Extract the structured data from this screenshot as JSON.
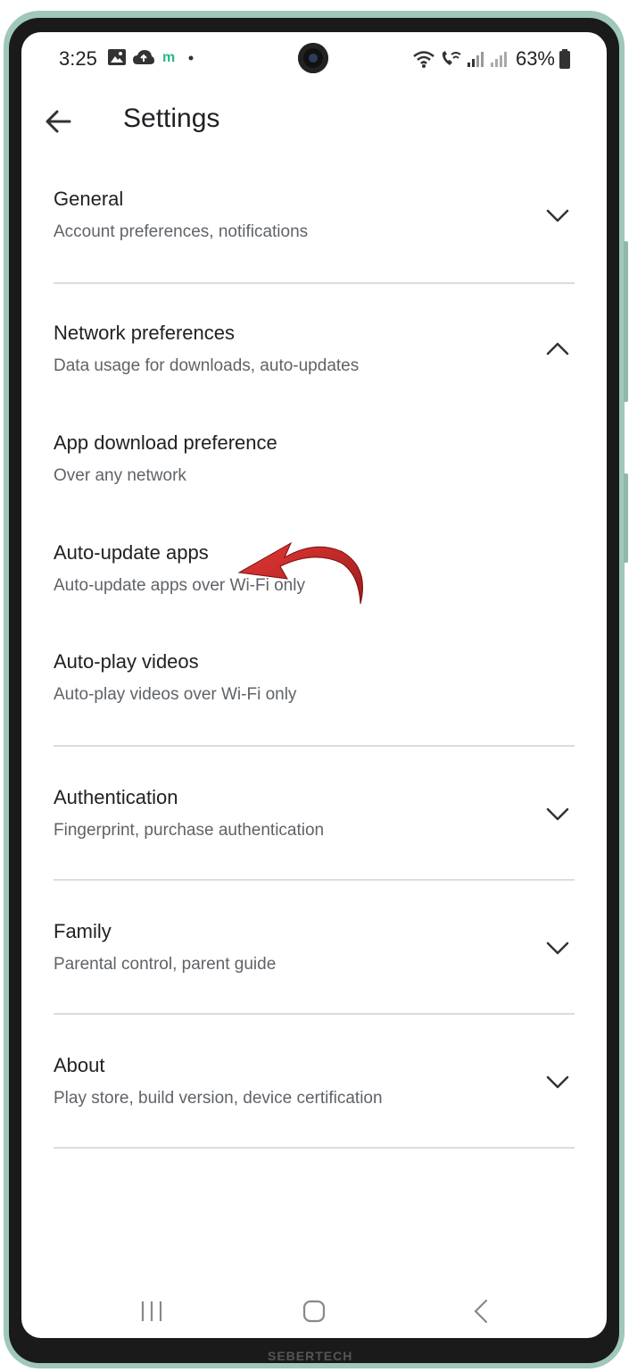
{
  "status_bar": {
    "time": "3:25",
    "battery_percent": "63%",
    "left_icons": [
      "image-icon",
      "cloud-upload-icon",
      "m-app-icon",
      "dot-icon"
    ],
    "right_icons": [
      "wifi-icon",
      "wifi-call-icon",
      "signal-icon",
      "signal-empty-icon",
      "battery-icon"
    ]
  },
  "app_bar": {
    "title": "Settings",
    "back_icon": "arrow-back-icon"
  },
  "sections": [
    {
      "title": "General",
      "subtitle": "Account preferences, notifications",
      "expanded": false
    },
    {
      "title": "Network preferences",
      "subtitle": "Data usage for downloads, auto-updates",
      "expanded": true
    },
    {
      "title": "App download preference",
      "subtitle": "Over any network"
    },
    {
      "title": "Auto-update apps",
      "subtitle": "Auto-update apps over Wi-Fi only"
    },
    {
      "title": "Auto-play videos",
      "subtitle": "Auto-play videos over Wi-Fi only"
    },
    {
      "title": "Authentication",
      "subtitle": "Fingerprint, purchase authentication",
      "expanded": false
    },
    {
      "title": "Family",
      "subtitle": "Parental control, parent guide",
      "expanded": false
    },
    {
      "title": "About",
      "subtitle": "Play store, build version, device certification",
      "expanded": false
    }
  ],
  "nav_bar": {
    "buttons": [
      "recent-apps-icon",
      "home-icon",
      "back-nav-icon"
    ]
  },
  "annotation": {
    "color": "#c62828",
    "icon": "red-curved-arrow"
  },
  "watermark": "SEBERTECH",
  "colors": {
    "frame": "#9fc8b8",
    "title": "#202124",
    "subtitle": "#5f6368",
    "divider": "#dadce0"
  }
}
